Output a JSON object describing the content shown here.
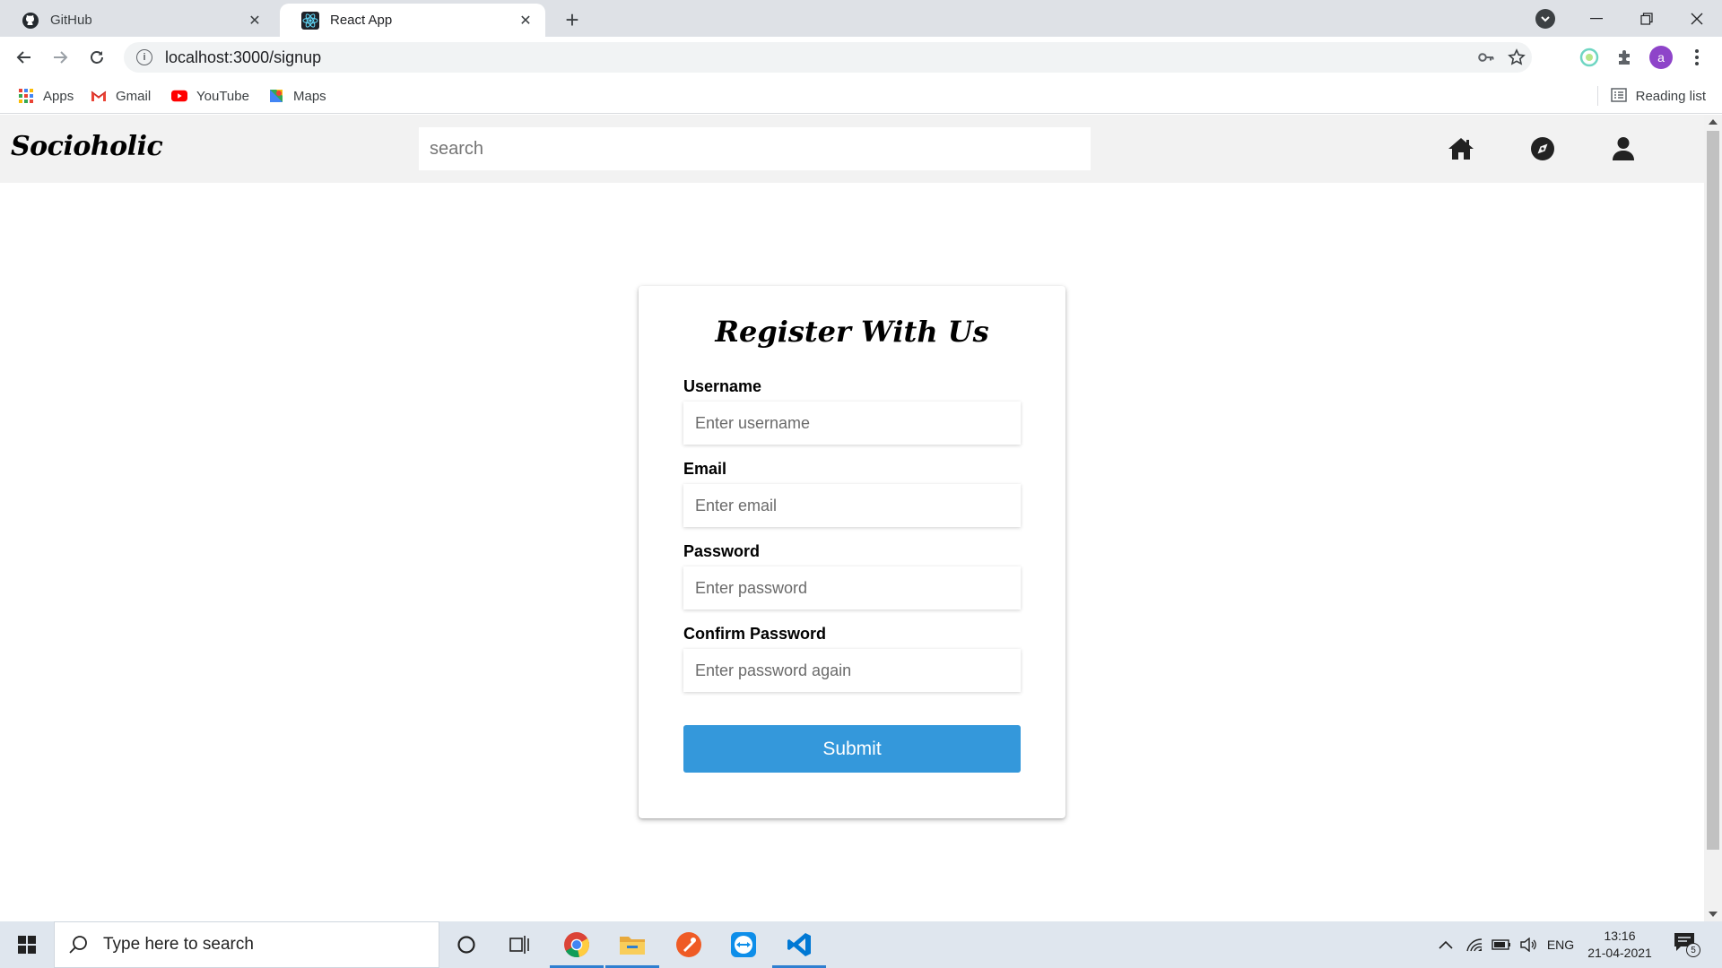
{
  "browser": {
    "tabs": [
      {
        "title": "GitHub",
        "active": false,
        "icon": "github-icon"
      },
      {
        "title": "React App",
        "active": true,
        "icon": "react-icon"
      }
    ],
    "new_tab_symbol": "+",
    "url": "localhost:3000/signup",
    "profile_initial": "a",
    "bookmarks": [
      {
        "label": "Apps",
        "icon": "apps-grid-icon"
      },
      {
        "label": "Gmail",
        "icon": "gmail-icon"
      },
      {
        "label": "YouTube",
        "icon": "youtube-icon"
      },
      {
        "label": "Maps",
        "icon": "maps-icon"
      }
    ],
    "reading_list": "Reading list"
  },
  "app": {
    "brand": "Socioholic",
    "search_placeholder": "search",
    "nav_icons": [
      "home-icon",
      "compass-icon",
      "user-icon"
    ]
  },
  "form": {
    "title": "Register With Us",
    "fields": [
      {
        "label": "Username",
        "placeholder": "Enter username",
        "type": "text"
      },
      {
        "label": "Email",
        "placeholder": "Enter email",
        "type": "email"
      },
      {
        "label": "Password",
        "placeholder": "Enter password",
        "type": "password"
      },
      {
        "label": "Confirm Password",
        "placeholder": "Enter password again",
        "type": "password"
      }
    ],
    "submit_label": "Submit",
    "submit_color": "#3498db"
  },
  "taskbar": {
    "search_placeholder": "Type here to search",
    "language": "ENG",
    "time": "13:16",
    "date": "21-04-2021",
    "notification_count": "5"
  }
}
